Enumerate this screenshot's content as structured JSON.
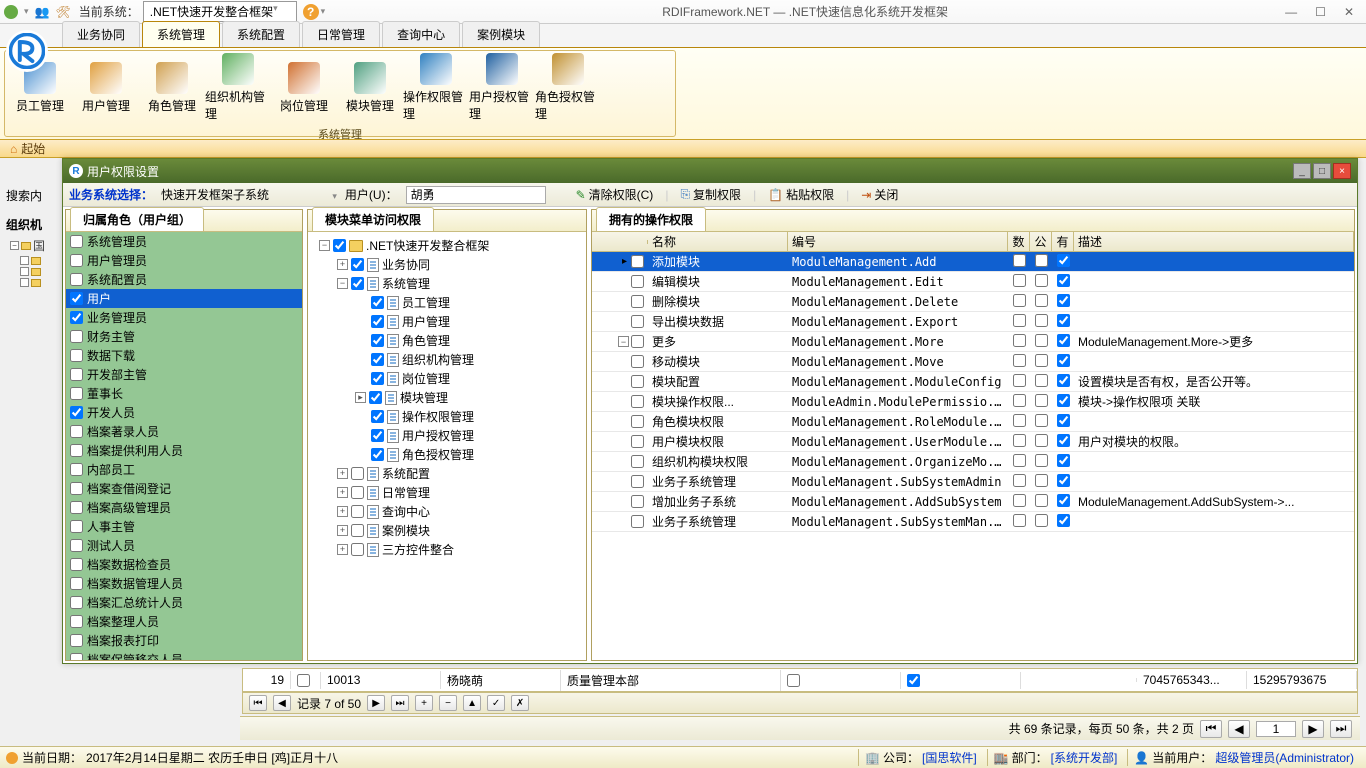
{
  "titlebar": {
    "system_label": "当前系统：",
    "system_value": ".NET快速开发整合框架",
    "app_title": "RDIFramework.NET — .NET快速信息化系统开发框架"
  },
  "main_tabs": [
    "业务协同",
    "系统管理",
    "系统配置",
    "日常管理",
    "查询中心",
    "案例模块"
  ],
  "main_tab_active": 1,
  "ribbon": {
    "items": [
      "员工管理",
      "用户管理",
      "角色管理",
      "组织机构管理",
      "岗位管理",
      "模块管理",
      "操作权限管理",
      "用户授权管理",
      "角色授权管理"
    ],
    "group_title": "系统管理"
  },
  "start_tab": "起始",
  "left": {
    "search_label": "搜索内",
    "org_label": "组织机"
  },
  "orgtree": [
    {
      "lvl": 0,
      "tg": "−",
      "txt": "国"
    },
    {
      "lvl": 1,
      "tg": "",
      "txt": ""
    },
    {
      "lvl": 1,
      "tg": "",
      "txt": ""
    },
    {
      "lvl": 1,
      "tg": "",
      "txt": ""
    }
  ],
  "inner": {
    "title": "用户权限设置",
    "toolbar": {
      "biz_label": "业务系统选择：",
      "biz_value": "快速开发框架子系统",
      "user_label": "用户(U)：",
      "user_value": "胡勇",
      "clear": "清除权限(C)",
      "copy": "复制权限",
      "paste": "粘贴权限",
      "close": "关闭"
    },
    "panel_roles_title": "归属角色（用户组）",
    "panel_modules_title": "模块菜单访问权限",
    "panel_perms_title": "拥有的操作权限",
    "roles": [
      {
        "label": "系统管理员",
        "checked": false
      },
      {
        "label": "用户管理员",
        "checked": false
      },
      {
        "label": "系统配置员",
        "checked": false
      },
      {
        "label": "用户",
        "checked": true,
        "selected": true
      },
      {
        "label": "业务管理员",
        "checked": true
      },
      {
        "label": "财务主管",
        "checked": false
      },
      {
        "label": "数据下载",
        "checked": false
      },
      {
        "label": "开发部主管",
        "checked": false
      },
      {
        "label": "董事长",
        "checked": false
      },
      {
        "label": "开发人员",
        "checked": true
      },
      {
        "label": "档案著录人员",
        "checked": false
      },
      {
        "label": "档案提供利用人员",
        "checked": false
      },
      {
        "label": "内部员工",
        "checked": false
      },
      {
        "label": "档案查借阅登记",
        "checked": false
      },
      {
        "label": "档案高级管理员",
        "checked": false
      },
      {
        "label": "人事主管",
        "checked": false
      },
      {
        "label": "测试人员",
        "checked": false
      },
      {
        "label": "档案数据检查员",
        "checked": false
      },
      {
        "label": "档案数据管理人员",
        "checked": false
      },
      {
        "label": "档案汇总统计人员",
        "checked": false
      },
      {
        "label": "档案整理人员",
        "checked": false
      },
      {
        "label": "档案报表打印",
        "checked": false
      },
      {
        "label": "档案保管移交人员",
        "checked": false
      }
    ],
    "module_tree": [
      {
        "lvl": 0,
        "tg": "−",
        "chk": true,
        "icon": "f",
        "label": ".NET快速开发整合框架"
      },
      {
        "lvl": 1,
        "tg": "+",
        "chk": true,
        "icon": "p",
        "label": "业务协同"
      },
      {
        "lvl": 1,
        "tg": "−",
        "chk": true,
        "icon": "p",
        "label": "系统管理"
      },
      {
        "lvl": 2,
        "tg": "",
        "chk": true,
        "icon": "p",
        "label": "员工管理"
      },
      {
        "lvl": 2,
        "tg": "",
        "chk": true,
        "icon": "p",
        "label": "用户管理"
      },
      {
        "lvl": 2,
        "tg": "",
        "chk": true,
        "icon": "p",
        "label": "角色管理"
      },
      {
        "lvl": 2,
        "tg": "",
        "chk": true,
        "icon": "p",
        "label": "组织机构管理"
      },
      {
        "lvl": 2,
        "tg": "",
        "chk": true,
        "icon": "p",
        "label": "岗位管理"
      },
      {
        "lvl": 2,
        "tg": "▸",
        "chk": true,
        "icon": "p",
        "label": "模块管理"
      },
      {
        "lvl": 2,
        "tg": "",
        "chk": true,
        "icon": "p",
        "label": "操作权限管理"
      },
      {
        "lvl": 2,
        "tg": "",
        "chk": true,
        "icon": "p",
        "label": "用户授权管理"
      },
      {
        "lvl": 2,
        "tg": "",
        "chk": true,
        "icon": "p",
        "label": "角色授权管理"
      },
      {
        "lvl": 1,
        "tg": "+",
        "chk": false,
        "icon": "p",
        "label": "系统配置"
      },
      {
        "lvl": 1,
        "tg": "+",
        "chk": false,
        "icon": "p",
        "label": "日常管理"
      },
      {
        "lvl": 1,
        "tg": "+",
        "chk": false,
        "icon": "p",
        "label": "查询中心"
      },
      {
        "lvl": 1,
        "tg": "+",
        "chk": false,
        "icon": "p",
        "label": "案例模块"
      },
      {
        "lvl": 1,
        "tg": "+",
        "chk": false,
        "icon": "p",
        "label": "三方控件整合"
      }
    ],
    "perm_headers": {
      "name": "名称",
      "code": "编号",
      "c1": "数",
      "c2": "公",
      "c3": "有",
      "desc": "描述"
    },
    "perms": [
      {
        "lvl": 0,
        "tg": "",
        "name": "添加模块",
        "code": "ModuleManagement.Add",
        "c1": false,
        "c2": false,
        "c3": true,
        "desc": "",
        "selected": true,
        "pre": "▸"
      },
      {
        "lvl": 0,
        "tg": "",
        "name": "编辑模块",
        "code": "ModuleManagement.Edit",
        "c1": false,
        "c2": false,
        "c3": true,
        "desc": ""
      },
      {
        "lvl": 0,
        "tg": "",
        "name": "删除模块",
        "code": "ModuleManagement.Delete",
        "c1": false,
        "c2": false,
        "c3": true,
        "desc": ""
      },
      {
        "lvl": 0,
        "tg": "",
        "name": "导出模块数据",
        "code": "ModuleManagement.Export",
        "c1": false,
        "c2": false,
        "c3": true,
        "desc": ""
      },
      {
        "lvl": 0,
        "tg": "−",
        "name": "更多",
        "code": "ModuleManagement.More",
        "c1": false,
        "c2": false,
        "c3": true,
        "desc": "ModuleManagement.More->更多"
      },
      {
        "lvl": 1,
        "tg": "",
        "name": "移动模块",
        "code": "ModuleManagement.Move",
        "c1": false,
        "c2": false,
        "c3": true,
        "desc": ""
      },
      {
        "lvl": 1,
        "tg": "",
        "name": "模块配置",
        "code": "ModuleManagement.ModuleConfig",
        "c1": false,
        "c2": false,
        "c3": true,
        "desc": "设置模块是否有权，是否公开等。"
      },
      {
        "lvl": 1,
        "tg": "",
        "name": "模块操作权限...",
        "code": "ModuleAdmin.ModulePermissio...",
        "c1": false,
        "c2": false,
        "c3": true,
        "desc": "模块->操作权限项 关联"
      },
      {
        "lvl": 1,
        "tg": "",
        "name": "角色模块权限",
        "code": "ModuleManagement.RoleModule...",
        "c1": false,
        "c2": false,
        "c3": true,
        "desc": ""
      },
      {
        "lvl": 1,
        "tg": "",
        "name": "用户模块权限",
        "code": "ModuleManagement.UserModule...",
        "c1": false,
        "c2": false,
        "c3": true,
        "desc": "用户对模块的权限。"
      },
      {
        "lvl": 1,
        "tg": "",
        "name": "组织机构模块权限",
        "code": "ModuleManagement.OrganizeMo...",
        "c1": false,
        "c2": false,
        "c3": true,
        "desc": ""
      },
      {
        "lvl": 1,
        "tg": "",
        "name": "业务子系统管理",
        "code": "ModuleManagent.SubSystemAdmin",
        "c1": false,
        "c2": false,
        "c3": true,
        "desc": ""
      },
      {
        "lvl": 1,
        "tg": "",
        "name": "增加业务子系统",
        "code": "ModuleManagement.AddSubSystem",
        "c1": false,
        "c2": false,
        "c3": true,
        "desc": "ModuleManagement.AddSubSystem->..."
      },
      {
        "lvl": 0,
        "tg": "",
        "name": "业务子系统管理",
        "code": "ModuleManagent.SubSystemMan...",
        "c1": false,
        "c2": false,
        "c3": true,
        "desc": ""
      }
    ],
    "lower": {
      "c1": "19",
      "c2": "10013",
      "c3": "杨晓萌",
      "c4": "质量管理本部",
      "c5": "7045765343...",
      "c6": "15295793675"
    },
    "nav": {
      "label": "记录 7 of 50"
    }
  },
  "paging": {
    "summary": "共 69 条记录，每页 50 条，共 2 页",
    "page": "1"
  },
  "status": {
    "date_label": "当前日期：",
    "date": "2017年2月14日星期二  农历壬申日 [鸡]正月十八",
    "company_label": "公司：",
    "company": "[国思软件]",
    "dept_label": "部门：",
    "dept": "[系统开发部]",
    "user_label": "当前用户：",
    "user": "超级管理员(Administrator)"
  }
}
